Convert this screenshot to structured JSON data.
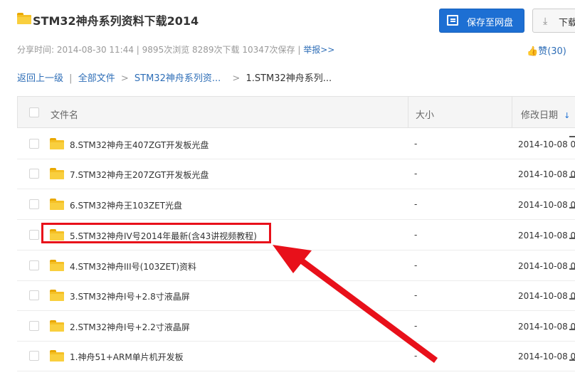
{
  "page": {
    "title": "STM32神舟系列资料下载2014",
    "meta_text": "分享时间: 2014-08-30 11:44 | 9895次浏览  8289次下载  10347次保存 |",
    "report_label": "举报>>",
    "save_button": "保存至网盘",
    "download_button": "下载",
    "like_icon": "thumb-up-icon",
    "like_label": "赞(30)"
  },
  "breadcrumb": {
    "back": "返回上一级",
    "all_files": "全部文件",
    "level1": "STM32神舟系列资...",
    "level2": "1.STM32神舟系列..."
  },
  "table": {
    "headers": {
      "name": "文件名",
      "size": "大小",
      "modified": "修改日期"
    },
    "rows": [
      {
        "name": "8.STM32神舟王407ZGT开发板光盘",
        "size": "-",
        "date": "2014-10-08 0"
      },
      {
        "name": "7.STM32神舟王207ZGT开发板光盘",
        "size": "-",
        "date": "2014-10-08 0"
      },
      {
        "name": "6.STM32神舟王103ZET光盘",
        "size": "-",
        "date": "2014-10-08 0"
      },
      {
        "name": "5.STM32神舟IV号2014年最新(含43讲视频教程)",
        "size": "-",
        "date": "2014-10-08 0"
      },
      {
        "name": "4.STM32神舟III号(103ZET)资料",
        "size": "-",
        "date": "2014-10-08 0"
      },
      {
        "name": "3.STM32神舟I号+2.8寸液晶屏",
        "size": "-",
        "date": "2014-10-08 0"
      },
      {
        "name": "2.STM32神舟I号+2.2寸液晶屏",
        "size": "-",
        "date": "2014-10-08 0"
      },
      {
        "name": "1.神舟51+ARM单片机开发板",
        "size": "-",
        "date": "2014-10-08 0"
      }
    ]
  },
  "annotation": {
    "highlight_color": "#e8101a",
    "highlighted_row_index": 3
  },
  "colors": {
    "accent": "#1d6fd3",
    "link": "#2e6eb7",
    "folder": "#f5c026"
  }
}
